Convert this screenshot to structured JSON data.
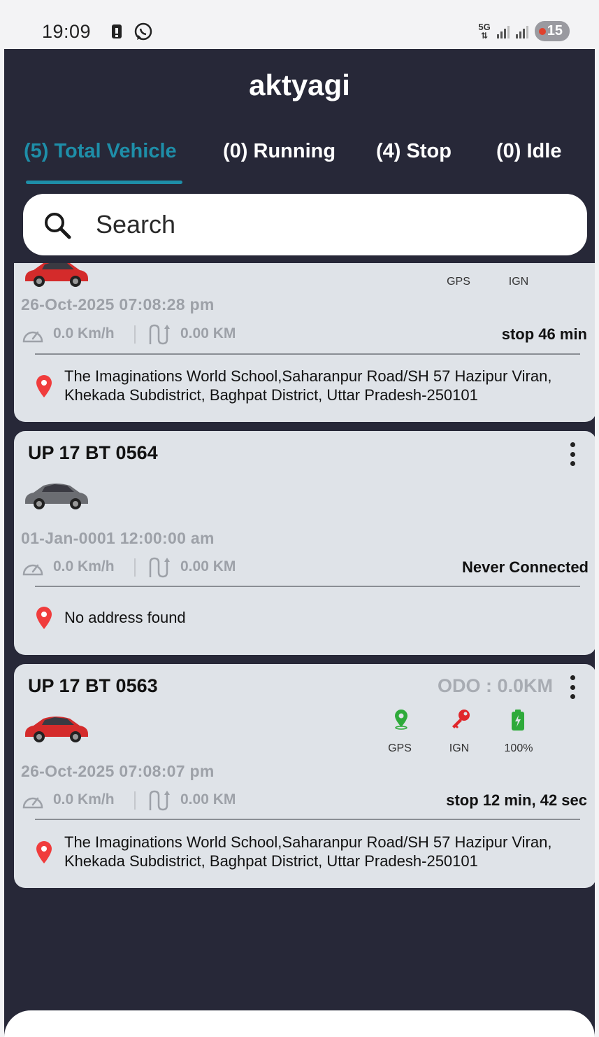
{
  "status_bar": {
    "time": "19:09",
    "network": "5G",
    "battery": "15"
  },
  "app": {
    "title": "aktyagi"
  },
  "tabs": [
    {
      "label": "(5) Total Vehicle",
      "active": true
    },
    {
      "label": "(0) Running",
      "active": false
    },
    {
      "label": "(4) Stop",
      "active": false
    },
    {
      "label": "(0) Idle",
      "active": false
    }
  ],
  "search": {
    "placeholder": "Search"
  },
  "vehicles": [
    {
      "title": "",
      "car_color": "#d42b2b",
      "gps_label": "GPS",
      "ign_label": "IGN",
      "datetime": "26-Oct-2025 07:08:28 pm",
      "speed": "0.0 Km/h",
      "distance": "0.00 KM",
      "status": "stop 46 min",
      "address": "The Imaginations World School,Saharanpur Road/SH 57 Hazipur Viran, Khekada Subdistrict, Baghpat District, Uttar Pradesh-250101"
    },
    {
      "title": "UP 17 BT 0564",
      "car_color": "#6b6d72",
      "datetime": "01-Jan-0001 12:00:00 am",
      "speed": "0.0 Km/h",
      "distance": "0.00 KM",
      "status": "Never Connected",
      "address": "No address found"
    },
    {
      "title": "UP 17 BT 0563",
      "car_color": "#d42b2b",
      "odo": "ODO : 0.0KM",
      "gps_label": "GPS",
      "ign_label": "IGN",
      "battery_label": "100%",
      "datetime": "26-Oct-2025 07:08:07 pm",
      "speed": "0.0 Km/h",
      "distance": "0.00 KM",
      "status": "stop 12 min, 42 sec",
      "address": "The Imaginations World School,Saharanpur Road/SH 57 Hazipur Viran, Khekada Subdistrict, Baghpat District, Uttar Pradesh-250101"
    }
  ],
  "colors": {
    "background": "#272838",
    "accent": "#1e8ea8",
    "card": "#dfe3e8",
    "gps_green": "#2eaa3a",
    "ign_red": "#e0262b",
    "pin_red": "#f03c3c"
  },
  "icons": [
    "search-icon",
    "speedometer-icon",
    "route-icon",
    "location-pin-icon",
    "gps-icon",
    "ignition-key-icon",
    "battery-icon",
    "more-vert-icon",
    "car-icon"
  ]
}
